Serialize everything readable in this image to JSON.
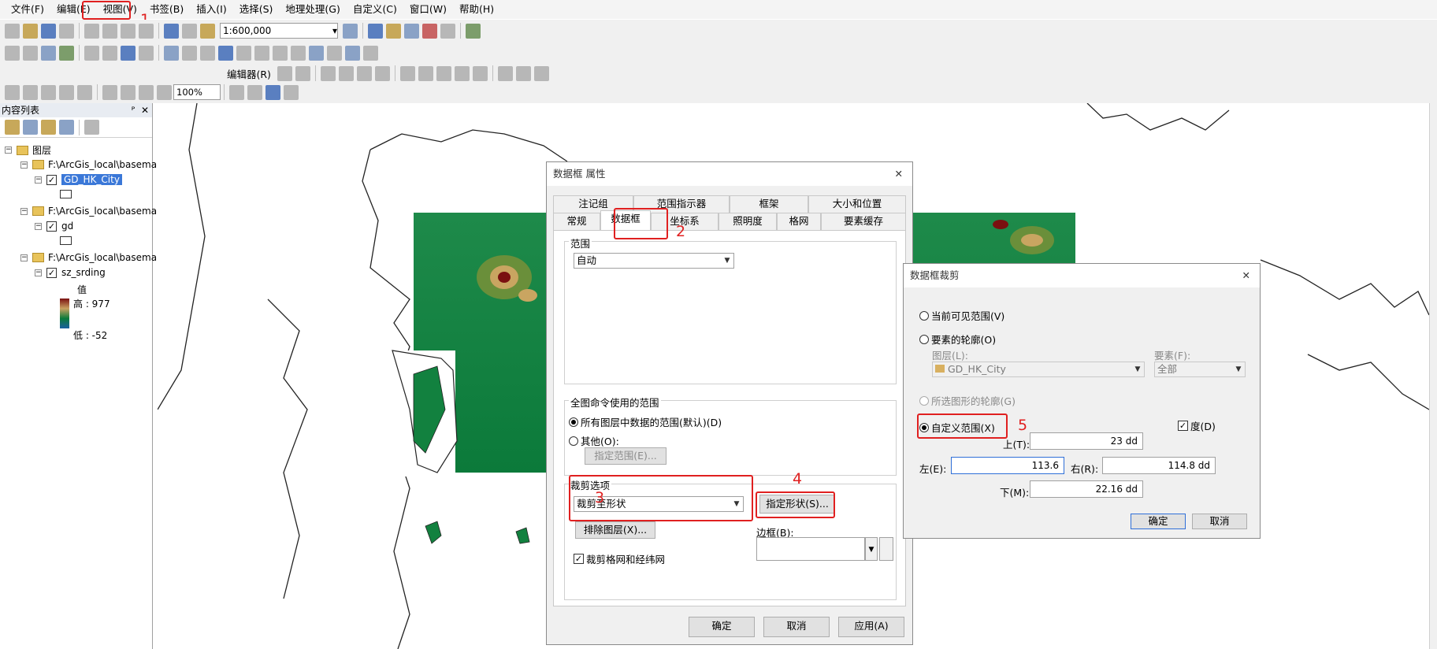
{
  "menubar": {
    "file": "文件(F)",
    "edit": "编辑(E)",
    "view": "视图(V)",
    "bookmark": "书签(B)",
    "insert": "插入(I)",
    "select": "选择(S)",
    "geoprocessing": "地理处理(G)",
    "customize": "自定义(C)",
    "window": "窗口(W)",
    "help": "帮助(H)"
  },
  "toolbar": {
    "scale_value": "1:600,000",
    "editor_label": "编辑器(R)",
    "zoom_value": "100%"
  },
  "toc": {
    "title": "内容列表",
    "pin": "ᴾ",
    "close": "✕",
    "root": "图层",
    "layers": [
      {
        "path": "F:\\ArcGis_local\\basema",
        "name": "GD_HK_City"
      },
      {
        "path": "F:\\ArcGis_local\\basema",
        "name": "gd"
      },
      {
        "path": "F:\\ArcGis_local\\basema",
        "name": "sz_srding",
        "legend_title": "值",
        "high": "高 : 977",
        "low": "低 : -52"
      }
    ]
  },
  "dataframe_dialog": {
    "title": "数据框 属性",
    "close": "✕",
    "tabs_row1": [
      "注记组",
      "范围指示器",
      "框架",
      "大小和位置"
    ],
    "tabs_row2": [
      "常规",
      "数据框",
      "坐标系",
      "照明度",
      "格网",
      "要素缓存"
    ],
    "extent_group": "范围",
    "extent_value": "自动",
    "fullextent_group": "全图命令使用的范围",
    "fullextent_all": "所有图层中数据的范围(默认)(D)",
    "fullextent_other": "其他(O):",
    "specify_extent": "指定范围(E)...",
    "clip_group": "裁剪选项",
    "clip_value": "裁剪至形状",
    "specify_shape": "指定形状(S)...",
    "exclude_layers": "排除图层(X)...",
    "border_label": "边框(B):",
    "clip_grid": "裁剪格网和经纬网",
    "ok": "确定",
    "cancel": "取消",
    "apply": "应用(A)"
  },
  "clip_dialog": {
    "title": "数据框裁剪",
    "close": "✕",
    "opt_visible": "当前可见范围(V)",
    "opt_feature": "要素的轮廓(O)",
    "layer_label": "图层(L):",
    "layer_value": "GD_HK_City",
    "feature_label": "要素(F):",
    "feature_value": "全部",
    "opt_selected": "所选图形的轮廓(G)",
    "opt_custom": "自定义范围(X)",
    "degree_label": "度(D)",
    "top_label": "上(T):",
    "top_value": "23 dd",
    "left_label": "左(E):",
    "left_value": "113.6",
    "right_label": "右(R):",
    "right_value": "114.8 dd",
    "bottom_label": "下(M):",
    "bottom_value": "22.16 dd",
    "ok": "确定",
    "cancel": "取消"
  },
  "annotations": [
    "1",
    "2",
    "3",
    "4",
    "5"
  ],
  "colors": {
    "highlight": "#e02020",
    "selection": "#3b78d8",
    "dem_low": "#0b7a3a",
    "dem_high": "#7a1010"
  }
}
